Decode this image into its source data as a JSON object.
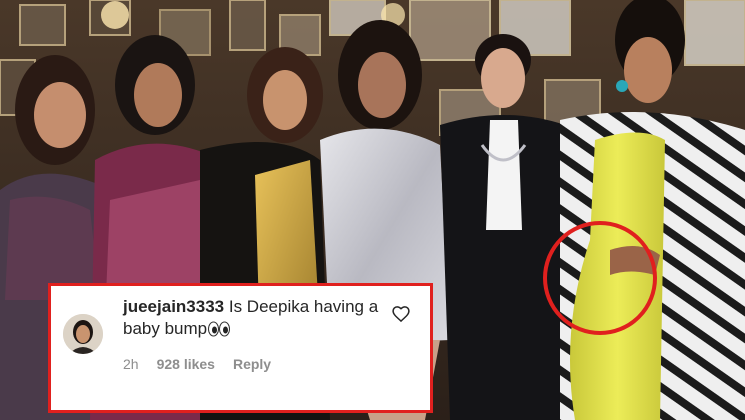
{
  "comment": {
    "username": "jueejain3333",
    "text_line1": "Is Deepika having a",
    "text_line2": "baby bump",
    "emoji": "eyes-emoji",
    "time": "2h",
    "likes": "928 likes",
    "reply_label": "Reply"
  },
  "colors": {
    "highlight_border": "#e0201e",
    "dress_yellow": "#e3e24a"
  },
  "icons": [
    "heart-icon",
    "eyes-emoji"
  ]
}
